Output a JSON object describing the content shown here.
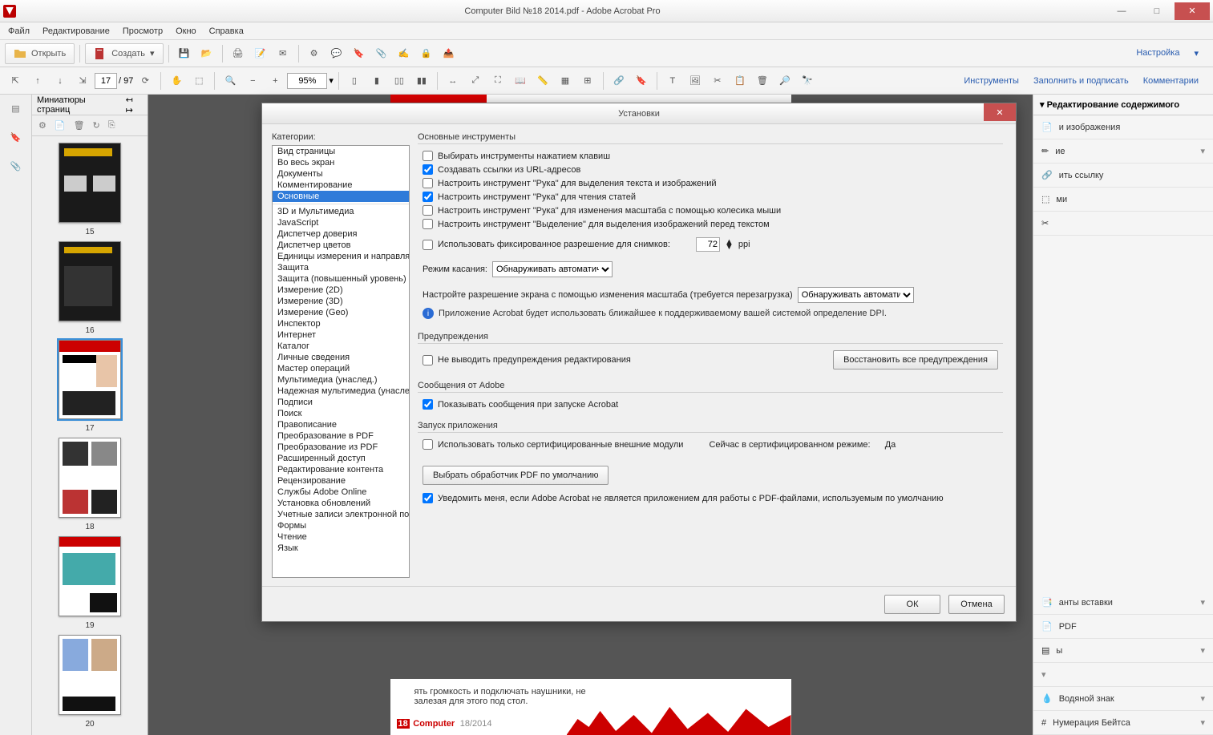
{
  "window": {
    "title": "Computer Bild №18 2014.pdf - Adobe Acrobat Pro"
  },
  "menu": [
    "Файл",
    "Редактирование",
    "Просмотр",
    "Окно",
    "Справка"
  ],
  "toolbar_main": {
    "open": "Открыть",
    "create": "Создать",
    "settings": "Настройка"
  },
  "page_nav": {
    "current": "17",
    "total": "97",
    "zoom": "95%"
  },
  "right_tabs": [
    "Инструменты",
    "Заполнить и подписать",
    "Комментарии"
  ],
  "thumbs": {
    "title": "Миниатюры страниц",
    "pages": [
      "15",
      "16",
      "17",
      "18",
      "19",
      "20"
    ]
  },
  "content_pane": {
    "title": "Редактирование содержимого",
    "items": [
      "и изображения",
      "ие",
      "ить ссылку",
      "ми",
      "анты вставки",
      "PDF",
      "ы",
      "Водяной знак",
      "Нумерация Бейтса"
    ]
  },
  "dialog": {
    "title": "Установки",
    "categories_label": "Категории:",
    "categories_top": [
      "Вид страницы",
      "Во весь экран",
      "Документы",
      "Комментирование",
      "Основные"
    ],
    "categories_bottom": [
      "3D и Мультимедиа",
      "JavaScript",
      "Диспетчер доверия",
      "Диспетчер цветов",
      "Единицы измерения и направляющие",
      "Защита",
      "Защита (повышенный уровень)",
      "Измерение (2D)",
      "Измерение (3D)",
      "Измерение (Geo)",
      "Инспектор",
      "Интернет",
      "Каталог",
      "Личные сведения",
      "Мастер операций",
      "Мультимедиа (унаслед.)",
      "Надежная мультимедиа (унаслед.)",
      "Подписи",
      "Поиск",
      "Правописание",
      "Преобразование в PDF",
      "Преобразование из PDF",
      "Расширенный доступ",
      "Редактирование контента",
      "Рецензирование",
      "Службы Adobe Online",
      "Установка обновлений",
      "Учетные записи электронной почты",
      "Формы",
      "Чтение",
      "Язык"
    ],
    "sel_category": "Основные",
    "groups": {
      "tools": {
        "label": "Основные инструменты",
        "opt1": "Выбирать инструменты нажатием клавиш",
        "opt2": "Создавать ссылки из URL-адресов",
        "opt3": "Настроить инструмент \"Рука\" для выделения текста и изображений",
        "opt4": "Настроить инструмент \"Рука\" для чтения статей",
        "opt5": "Настроить инструмент \"Рука\" для изменения масштаба с помощью колесика мыши",
        "opt6": "Настроить инструмент \"Выделение\" для выделения изображений перед текстом",
        "opt7": "Использовать фиксированное разрешение для снимков:",
        "ppi_value": "72",
        "ppi_unit": "ppi",
        "touch_label": "Режим касания:",
        "touch_value": "Обнаруживать автоматически",
        "screen_label": "Настройте разрешение экрана с помощью изменения масштаба (требуется перезагрузка)",
        "screen_value": "Обнаруживать автоматически",
        "dpi_note": "Приложение Acrobat будет использовать ближайшее к поддерживаемому вашей системой определение DPI."
      },
      "warn": {
        "label": "Предупреждения",
        "opt1": "Не выводить предупреждения редактирования",
        "reset": "Восстановить все предупреждения"
      },
      "msgs": {
        "label": "Сообщения от Adobe",
        "opt1": "Показывать сообщения при запуске Acrobat"
      },
      "launch": {
        "label": "Запуск приложения",
        "opt1": "Использовать только сертифицированные внешние модули",
        "cert_label": "Сейчас в сертифицированном режиме:",
        "cert_value": "Да",
        "default_btn": "Выбрать обработчик PDF по умолчанию",
        "notify": "Уведомить меня, если Adobe Acrobat не является приложением для работы с PDF-файлами, используемым по умолчанию"
      }
    },
    "ok": "ОК",
    "cancel": "Отмена"
  },
  "page_fragment": {
    "text1": "ять громкость и подключать наушники, не",
    "text2": "залезая для этого под стол.",
    "pagenum": "18",
    "magazine": "Computer",
    "issue": "18/2014"
  }
}
